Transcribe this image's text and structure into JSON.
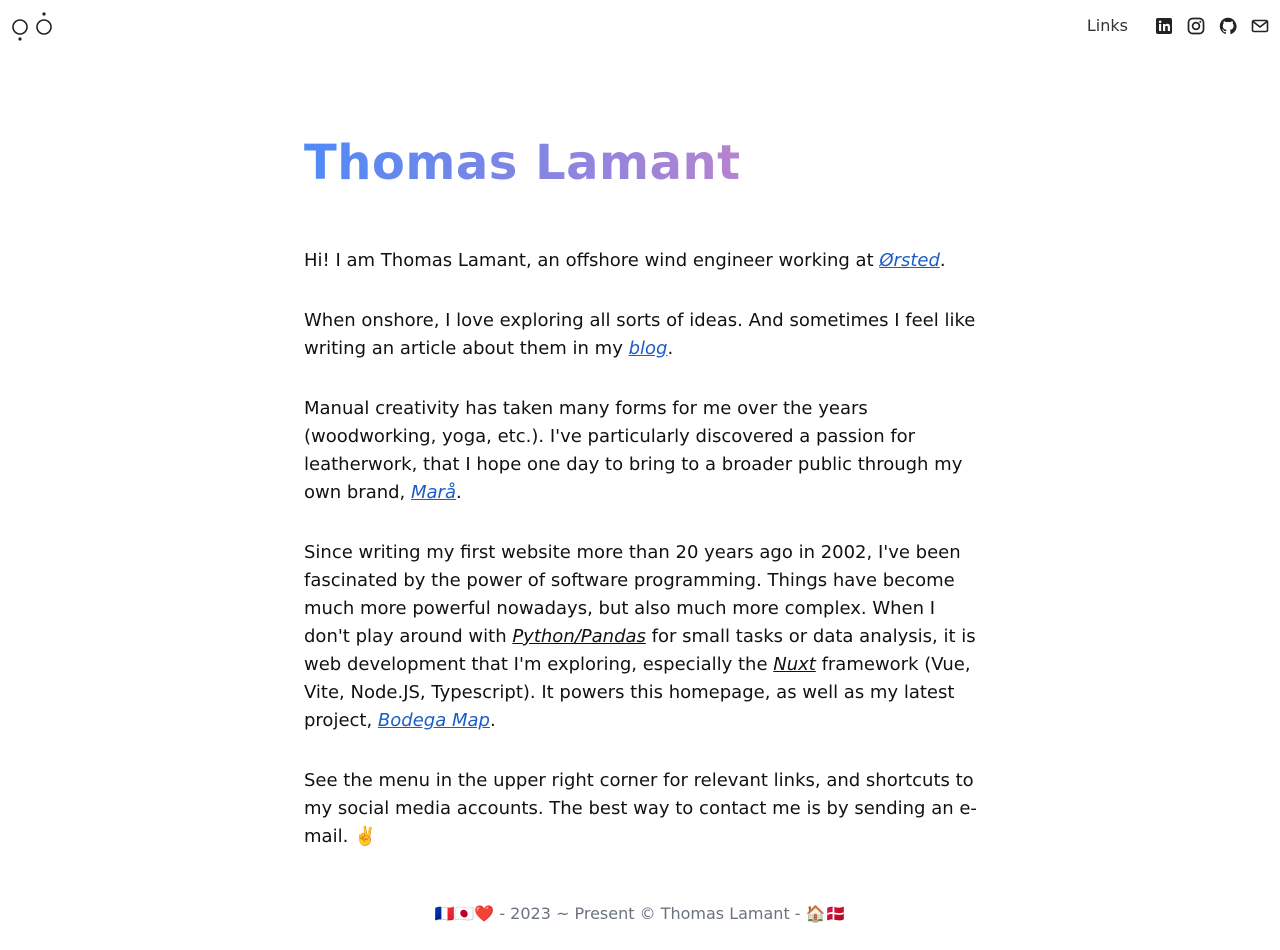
{
  "nav": {
    "links_label": "Links",
    "icons": [
      "linkedin-icon",
      "instagram-icon",
      "github-icon",
      "mail-icon"
    ]
  },
  "main": {
    "title": "Thomas Lamant",
    "p1": {
      "before": "Hi! I am Thomas Lamant, an offshore wind engineer working at ",
      "link": "Ørsted",
      "after": "."
    },
    "p2": {
      "before": "When onshore, I love exploring all sorts of ideas. And sometimes I feel like writing an article about them in my ",
      "link": "blog",
      "after": "."
    },
    "p3": {
      "before": "Manual creativity has taken many forms for me over the years (woodworking, yoga, etc.). I've particularly discovered a passion for leatherwork, that I hope one day to bring to a broader public through my own brand, ",
      "link": "Marå",
      "after": "."
    },
    "p4": {
      "part1": "Since writing my first website more than 20 years ago in 2002, I've been fascinated by the power of software programming. Things have become much more powerful nowadays, but also much more complex. When I don't play around with ",
      "link1": "Python/Pandas",
      "part2": " for small tasks or data analysis, it is web development that I'm exploring, especially the ",
      "link2": "Nuxt",
      "part3": " framework (Vue, Vite, Node.JS, Typescript). It powers this homepage, as well as my latest project, ",
      "link3": "Bodega Map",
      "part4": "."
    },
    "p5": "See the menu in the upper right corner for relevant links, and shortcuts to my social media accounts. The best way to contact me is by sending an e-mail. ✌️"
  },
  "footer": {
    "text": "🇫🇷🇯🇵❤️ - 2023 ~ Present © Thomas Lamant - 🏠🇩🇰"
  },
  "colors": {
    "link_blue": "#1a5dc8",
    "title_gradient_start": "#4f8af7",
    "title_gradient_end": "#b783cf",
    "footer_text": "#6b7280"
  }
}
